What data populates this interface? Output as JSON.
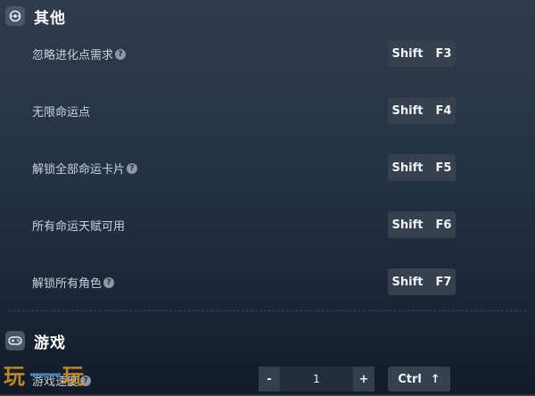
{
  "sections": {
    "other": {
      "title": "其他",
      "icon": "circle-dot-icon"
    },
    "game": {
      "title": "游戏",
      "icon": "gamepad-icon"
    }
  },
  "other_rows": [
    {
      "label": "忽略进化点需求",
      "help": true,
      "key_mod": "Shift",
      "key": "F3"
    },
    {
      "label": "无限命运点",
      "help": false,
      "key_mod": "Shift",
      "key": "F4"
    },
    {
      "label": "解锁全部命运卡片",
      "help": true,
      "key_mod": "Shift",
      "key": "F5"
    },
    {
      "label": "所有命运天赋可用",
      "help": false,
      "key_mod": "Shift",
      "key": "F6"
    },
    {
      "label": "解锁所有角色",
      "help": true,
      "key_mod": "Shift",
      "key": "F7"
    }
  ],
  "game_rows": [
    {
      "label": "游戏速度",
      "help": true,
      "stepper": {
        "minus": "-",
        "value": "1",
        "plus": "+"
      },
      "key_mod": "Ctrl",
      "key_symbol": "↑"
    }
  ],
  "help_glyph": "?",
  "watermark": {
    "text": "玩一玩"
  },
  "colors": {
    "accent_watermark": "#d99a2b",
    "key_bg": "#36404f"
  }
}
